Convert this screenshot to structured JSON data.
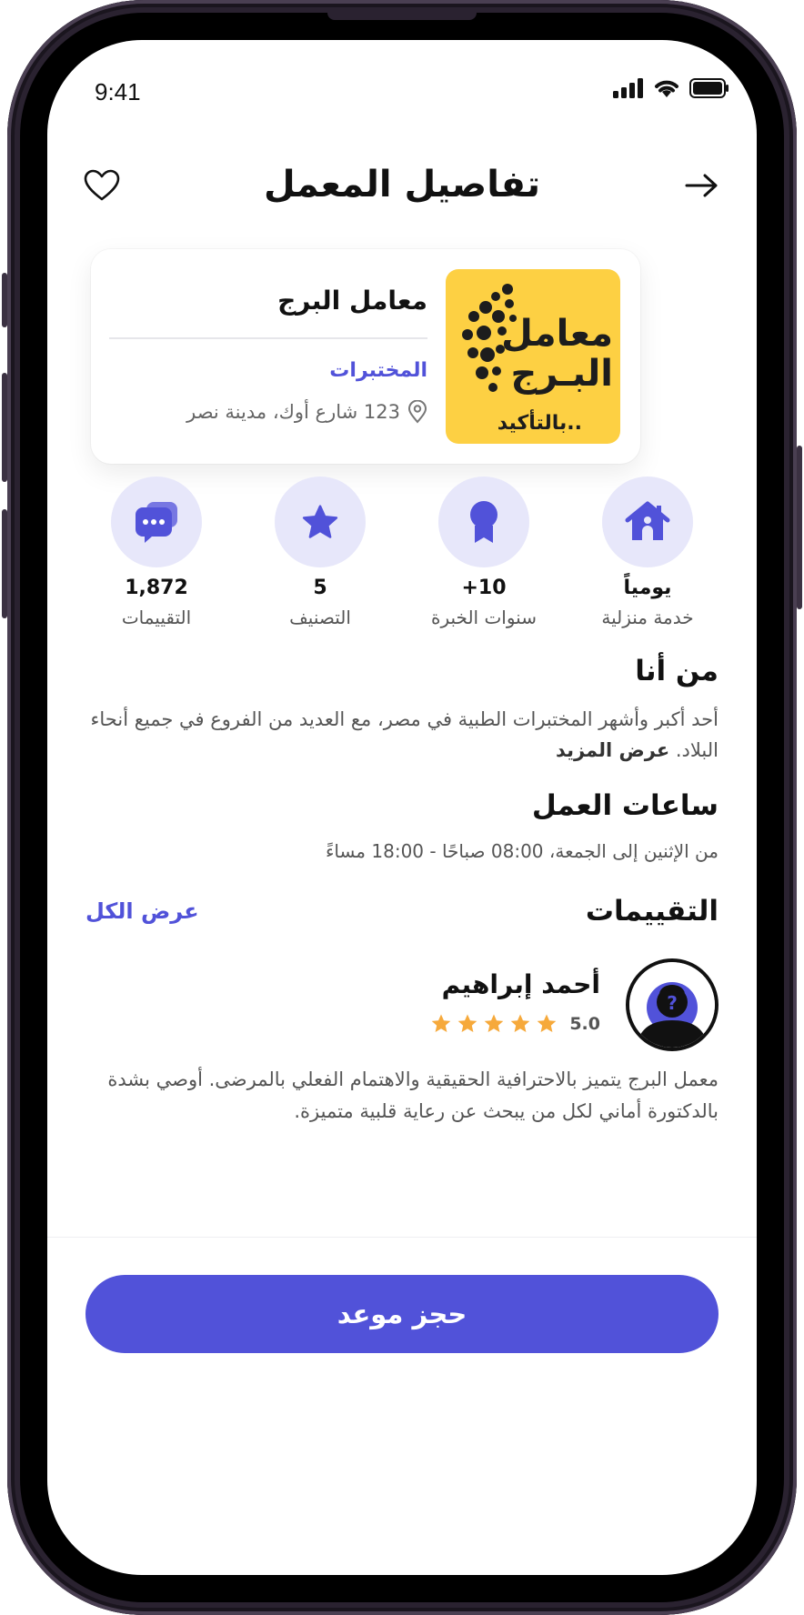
{
  "status_bar": {
    "time": "9:41"
  },
  "header": {
    "title": "تفاصيل المعمل"
  },
  "lab": {
    "name": "معامل البرج",
    "category": "المختبرات",
    "address": "123 شارع أوك، مدينة نصر",
    "logo": {
      "line1": "معامل",
      "line2": "البـرج",
      "tagline": "بالتأكيد.."
    }
  },
  "stats": [
    {
      "icon": "home-icon",
      "value": "يومياً",
      "label": "خدمة منزلية"
    },
    {
      "icon": "award-icon",
      "value": "10+",
      "label": "سنوات الخبرة"
    },
    {
      "icon": "star-icon",
      "value": "5",
      "label": "التصنيف"
    },
    {
      "icon": "chat-icon",
      "value": "1,872",
      "label": "التقييمات"
    }
  ],
  "about": {
    "title": "من أنا",
    "text": "أحد أكبر وأشهر المختبرات الطبية في مصر، مع العديد من الفروع في جميع أنحاء البلاد.",
    "more": "عرض المزيد"
  },
  "hours": {
    "title": "ساعات العمل",
    "text": "من الإثنين إلى الجمعة، 08:00 صباحًا - 18:00 مساءً"
  },
  "reviews": {
    "title": "التقييمات",
    "see_all": "عرض الكل",
    "item": {
      "name": "أحمد إبراهيم",
      "rating": "5.0",
      "stars": 5,
      "text": "معمل البرج يتميز بالاحترافية الحقيقية والاهتمام الفعلي بالمرضى. أوصي بشدة بالدكتورة أماني لكل من يبحث عن رعاية قلبية متميزة."
    }
  },
  "cta": {
    "label": "حجز موعد"
  },
  "colors": {
    "accent": "#5152d9",
    "accent_light": "#e7e7fa",
    "logo_bg": "#fdd043",
    "star": "#f6a93b"
  }
}
